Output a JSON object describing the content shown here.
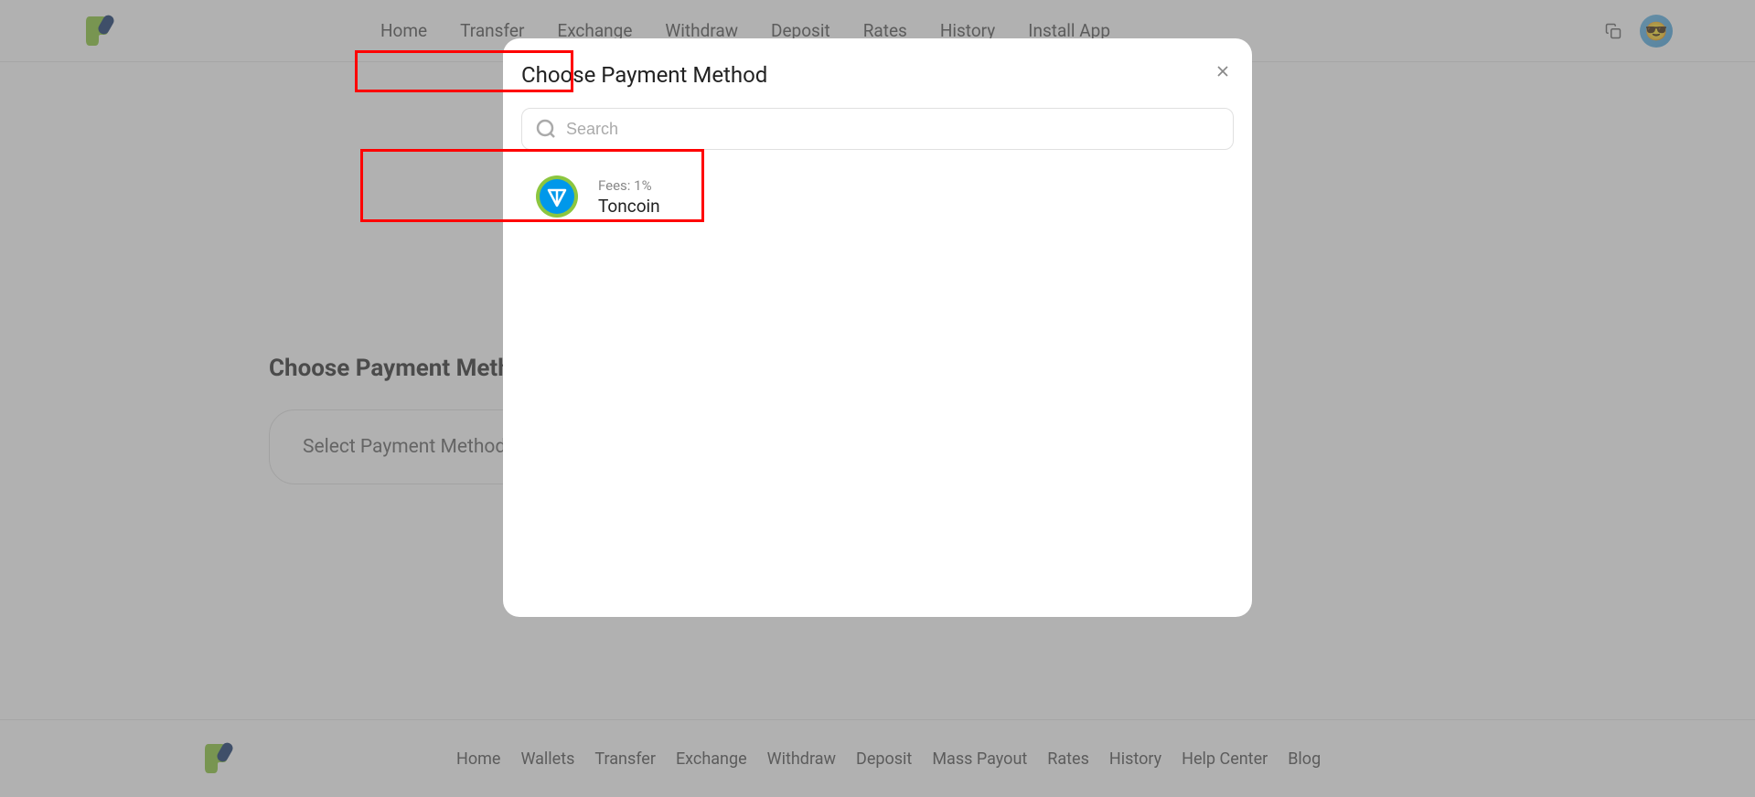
{
  "header": {
    "nav": [
      "Home",
      "Transfer",
      "Exchange",
      "Withdraw",
      "Deposit",
      "Rates",
      "History",
      "Install App"
    ]
  },
  "main": {
    "section_title": "Choose Payment Method",
    "select_placeholder": "Select Payment Method"
  },
  "footer": {
    "nav": [
      "Home",
      "Wallets",
      "Transfer",
      "Exchange",
      "Withdraw",
      "Deposit",
      "Mass Payout",
      "Rates",
      "History",
      "Help Center",
      "Blog"
    ]
  },
  "modal": {
    "title": "Choose Payment Method",
    "search_placeholder": "Search",
    "options": [
      {
        "fees_label": "Fees:",
        "fees_value": "1%",
        "name": "Toncoin"
      }
    ]
  }
}
